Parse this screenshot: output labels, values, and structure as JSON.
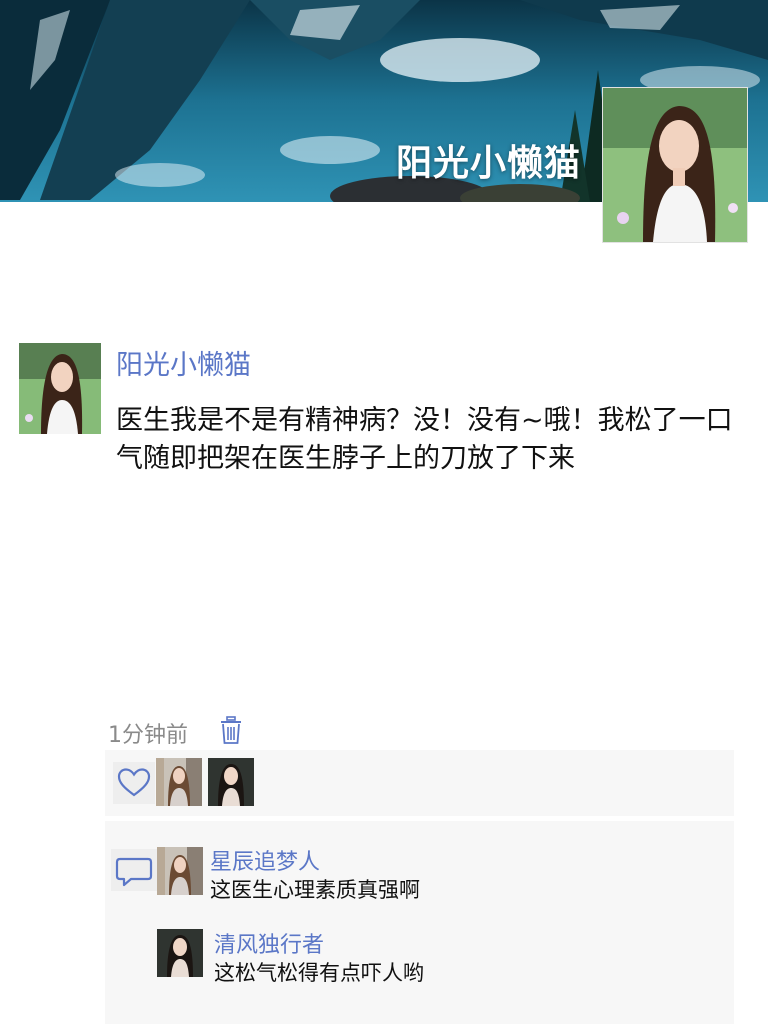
{
  "cover": {
    "user_name": "阳光小懒猫",
    "background": "mountain-lake-reflection",
    "avatar": "portrait-avatar"
  },
  "post": {
    "author": "阳光小懒猫",
    "content": "医生我是不是有精神病？没！没有~哦！我松了一口气随即把架在医生脖子上的刀放了下来",
    "time": "1分钟前",
    "delete_icon": "trash-icon"
  },
  "likes": {
    "icon": "heart-icon",
    "avatars": [
      "portrait-avatar",
      "portrait-avatar"
    ]
  },
  "comments": {
    "icon": "comment-icon",
    "items": [
      {
        "name": "星辰追梦人",
        "text": "这医生心理素质真强啊"
      },
      {
        "name": "清风独行者",
        "text": "这松气松得有点吓人哟"
      }
    ]
  },
  "colors": {
    "name_link": "#5b77c7",
    "panel_bg": "#f7f7f7",
    "meta_text": "#8a8a8a"
  }
}
